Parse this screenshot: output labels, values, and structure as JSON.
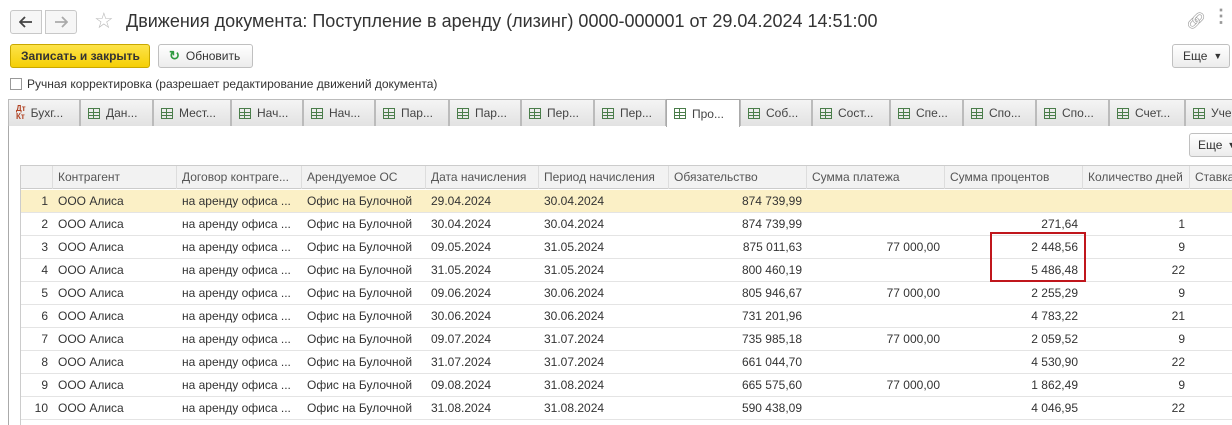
{
  "window": {
    "title": "Движения документа: Поступление в аренду (лизинг) 0000-000001 от 29.04.2024 14:51:00",
    "icons": [
      "arrow-left-icon",
      "arrow-right-icon",
      "star-icon",
      "link-icon",
      "more-icon",
      "close-icon"
    ]
  },
  "toolbar": {
    "save_close_label": "Записать и закрыть",
    "refresh_label": "Обновить",
    "more_label": "Еще"
  },
  "manual_correction_label": "Ручная корректировка (разрешает редактирование движений документа)",
  "tabs": [
    {
      "label": "Бухг..."
    },
    {
      "label": "Дан..."
    },
    {
      "label": "Мест..."
    },
    {
      "label": "Нач..."
    },
    {
      "label": "Нач..."
    },
    {
      "label": "Пар..."
    },
    {
      "label": "Пар..."
    },
    {
      "label": "Пер..."
    },
    {
      "label": "Пер..."
    },
    {
      "label": "Про...",
      "active": true
    },
    {
      "label": "Соб..."
    },
    {
      "label": "Сост..."
    },
    {
      "label": "Спе..."
    },
    {
      "label": "Спо..."
    },
    {
      "label": "Спо..."
    },
    {
      "label": "Счет..."
    },
    {
      "label": "Уче"
    }
  ],
  "grid_more_label": "Еще",
  "table": {
    "columns": [
      "",
      "Контрагент",
      "Договор контраге...",
      "Арендуемое ОС",
      "Дата начисления",
      "Период начисления",
      "Обязательство",
      "Сумма платежа",
      "Сумма процентов",
      "Количество дней",
      "Ставка"
    ],
    "rows": [
      [
        "1",
        "ООО Алиса",
        "на аренду офиса ...",
        "Офис на Булочной",
        "29.04.2024",
        "30.04.2024",
        "874 739,99",
        "",
        "",
        ""
      ],
      [
        "2",
        "ООО Алиса",
        "на аренду офиса ...",
        "Офис на Булочной",
        "30.04.2024",
        "30.04.2024",
        "874 739,99",
        "",
        "271,64",
        "1"
      ],
      [
        "3",
        "ООО Алиса",
        "на аренду офиса ...",
        "Офис на Булочной",
        "09.05.2024",
        "31.05.2024",
        "875 011,63",
        "77 000,00",
        "2 448,56",
        "9"
      ],
      [
        "4",
        "ООО Алиса",
        "на аренду офиса ...",
        "Офис на Булочной",
        "31.05.2024",
        "31.05.2024",
        "800 460,19",
        "",
        "5 486,48",
        "22"
      ],
      [
        "5",
        "ООО Алиса",
        "на аренду офиса ...",
        "Офис на Булочной",
        "09.06.2024",
        "30.06.2024",
        "805 946,67",
        "77 000,00",
        "2 255,29",
        "9"
      ],
      [
        "6",
        "ООО Алиса",
        "на аренду офиса ...",
        "Офис на Булочной",
        "30.06.2024",
        "30.06.2024",
        "731 201,96",
        "",
        "4 783,22",
        "21"
      ],
      [
        "7",
        "ООО Алиса",
        "на аренду офиса ...",
        "Офис на Булочной",
        "09.07.2024",
        "31.07.2024",
        "735 985,18",
        "77 000,00",
        "2 059,52",
        "9"
      ],
      [
        "8",
        "ООО Алиса",
        "на аренду офиса ...",
        "Офис на Булочной",
        "31.07.2024",
        "31.07.2024",
        "661 044,70",
        "",
        "4 530,90",
        "22"
      ],
      [
        "9",
        "ООО Алиса",
        "на аренду офиса ...",
        "Офис на Булочной",
        "09.08.2024",
        "31.08.2024",
        "665 575,60",
        "77 000,00",
        "1 862,49",
        "9"
      ],
      [
        "10",
        "ООО Алиса",
        "на аренду офиса ...",
        "Офис на Булочной",
        "31.08.2024",
        "31.08.2024",
        "590 438,09",
        "",
        "4 046,95",
        "22"
      ]
    ],
    "selected_row": 0,
    "highlight_color": "#c0161c"
  }
}
